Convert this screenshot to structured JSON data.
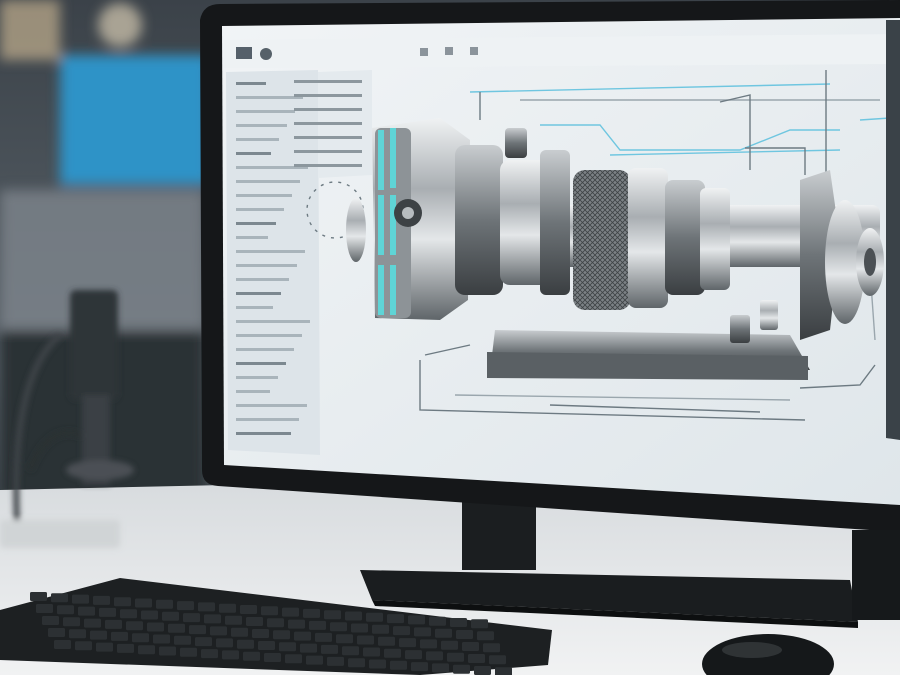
{
  "scene": {
    "subject": "desktop-monitor-showing-cad-application",
    "objects": [
      "monitor",
      "cad-window",
      "turbine-assembly-3d-model",
      "technical-drawing-lines",
      "keyboard",
      "mouse",
      "microscope-arm",
      "desk"
    ]
  },
  "cad_ui": {
    "toolbar_icons": [
      "menu-icon",
      "globe-icon",
      "tool-icon",
      "tool-icon",
      "tool-icon"
    ],
    "side_panel_rows": 26
  },
  "colors": {
    "screen_bg": "#e9eef1",
    "panel_bg": "#d9e0e5",
    "accent_cyan": "#5fd4d6",
    "blueprint_line": "#6fc6e0",
    "metal_light": "#d7dbde",
    "metal_dark": "#5c6266",
    "monitor_bezel": "#151719",
    "desk": "#e6e8ea",
    "background_blue": "#2f93c7",
    "background_wood": "#c9a27a"
  }
}
